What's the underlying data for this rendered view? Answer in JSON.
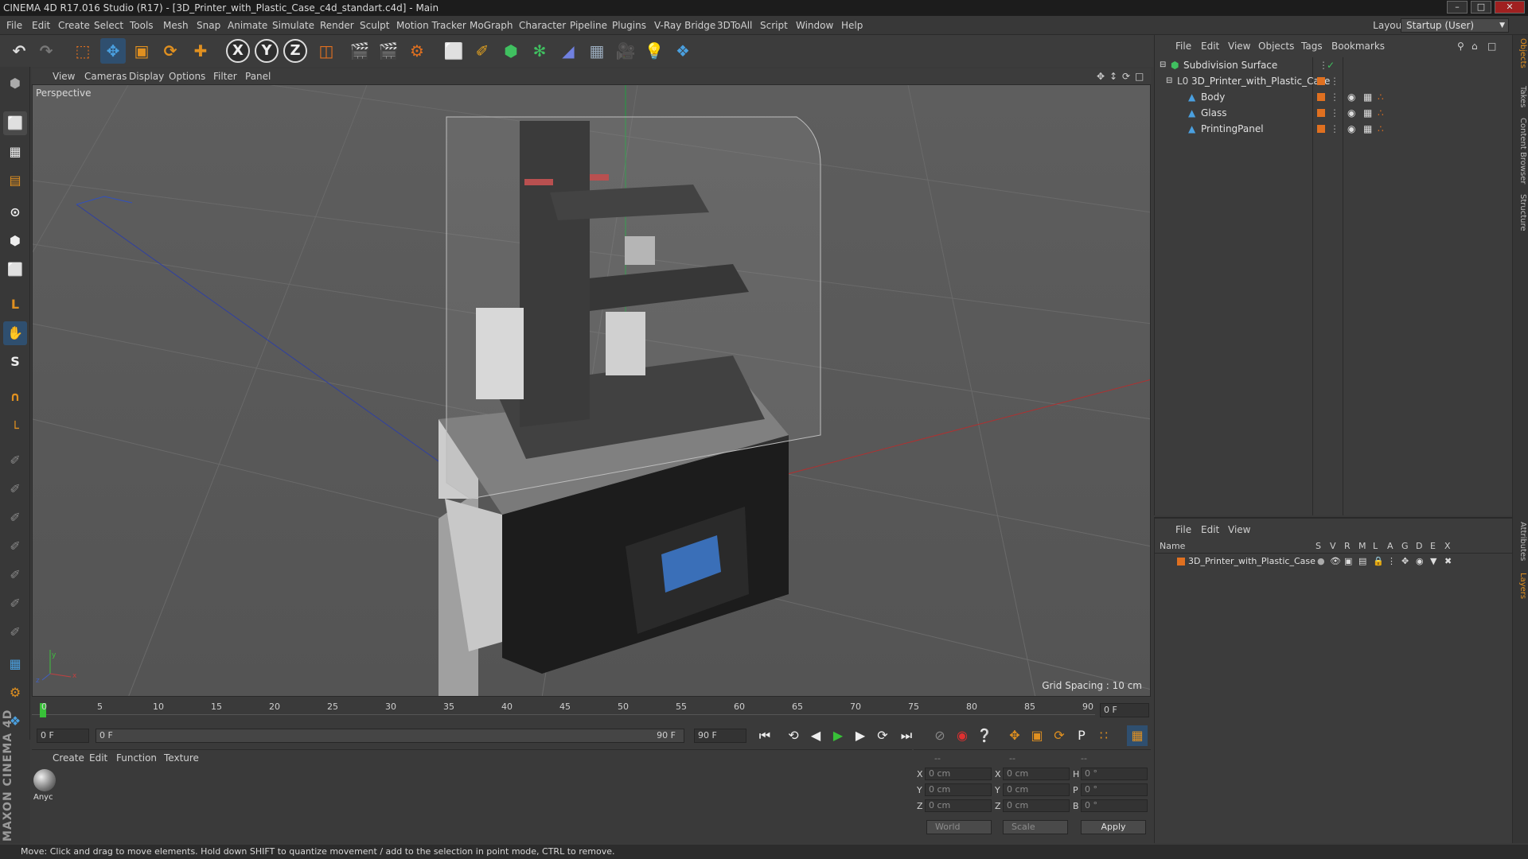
{
  "window": {
    "title": "CINEMA 4D R17.016 Studio (R17) - [3D_Printer_with_Plastic_Case_c4d_standart.c4d] - Main"
  },
  "menubar": {
    "items": [
      "File",
      "Edit",
      "Create",
      "Select",
      "Tools",
      "Mesh",
      "Snap",
      "Animate",
      "Simulate",
      "Render",
      "Sculpt",
      "Motion Tracker",
      "MoGraph",
      "Character",
      "Pipeline",
      "Plugins",
      "V-Ray Bridge",
      "3DToAll",
      "Script",
      "Window",
      "Help"
    ],
    "layout_label": "Layout:",
    "layout_value": "Startup (User)"
  },
  "toolbar": {
    "axis_x": "X",
    "axis_y": "Y",
    "axis_z": "Z"
  },
  "viewport": {
    "menu": [
      "View",
      "Cameras",
      "Display",
      "Options",
      "Filter",
      "Panel"
    ],
    "label": "Perspective",
    "grid_spacing": "Grid Spacing : 10 cm",
    "axis_x": "x",
    "axis_y": "y",
    "axis_z": "z"
  },
  "timeline": {
    "ticks": [
      "0",
      "5",
      "10",
      "15",
      "20",
      "25",
      "30",
      "35",
      "40",
      "45",
      "50",
      "55",
      "60",
      "65",
      "70",
      "75",
      "80",
      "85",
      "90"
    ],
    "current_frame": "0 F",
    "start_field": "0 F",
    "range_start": "0 F",
    "range_end": "90 F",
    "end_field": "90 F"
  },
  "materials": {
    "menu": [
      "Create",
      "Edit",
      "Function",
      "Texture"
    ],
    "items": [
      {
        "name": "Anyc"
      }
    ]
  },
  "coordinates": {
    "header": [
      "--",
      "--",
      "--"
    ],
    "rows": [
      {
        "pos_label": "X",
        "pos_value": "0 cm",
        "size_label": "X",
        "size_value": "0 cm",
        "rot_label": "H",
        "rot_value": "0 °"
      },
      {
        "pos_label": "Y",
        "pos_value": "0 cm",
        "size_label": "Y",
        "size_value": "0 cm",
        "rot_label": "P",
        "rot_value": "0 °"
      },
      {
        "pos_label": "Z",
        "pos_value": "0 cm",
        "size_label": "Z",
        "size_value": "0 cm",
        "rot_label": "B",
        "rot_value": "0 °"
      }
    ],
    "mode": "World",
    "transform": "Scale",
    "apply_label": "Apply"
  },
  "branding": {
    "logo_text": "MAXON CINEMA 4D"
  },
  "objects_panel": {
    "menu": [
      "File",
      "Edit",
      "View",
      "Objects",
      "Tags",
      "Bookmarks"
    ],
    "tree": [
      {
        "name": "Subdivision Surface"
      },
      {
        "name": "3D_Printer_with_Plastic_Case"
      },
      {
        "name": "Body"
      },
      {
        "name": "Glass"
      },
      {
        "name": "PrintingPanel"
      }
    ]
  },
  "layers_panel": {
    "menu": [
      "File",
      "Edit",
      "View"
    ],
    "name_header": "Name",
    "columns": [
      "S",
      "V",
      "R",
      "M",
      "L",
      "A",
      "G",
      "D",
      "E",
      "X"
    ],
    "layers": [
      {
        "name": "3D_Printer_with_Plastic_Case"
      }
    ]
  },
  "right_tabs": [
    "Objects",
    "Takes",
    "Content Browser",
    "Structure",
    "Attributes",
    "Layers"
  ],
  "status": {
    "text": "Move: Click and drag to move elements. Hold down SHIFT to quantize movement / add to the selection in point mode, CTRL to remove."
  },
  "colors": {
    "accent_orange": "#e07020",
    "accent_blue": "#4aa0e0",
    "play_green": "#38c038",
    "record_red": "#e03030"
  }
}
